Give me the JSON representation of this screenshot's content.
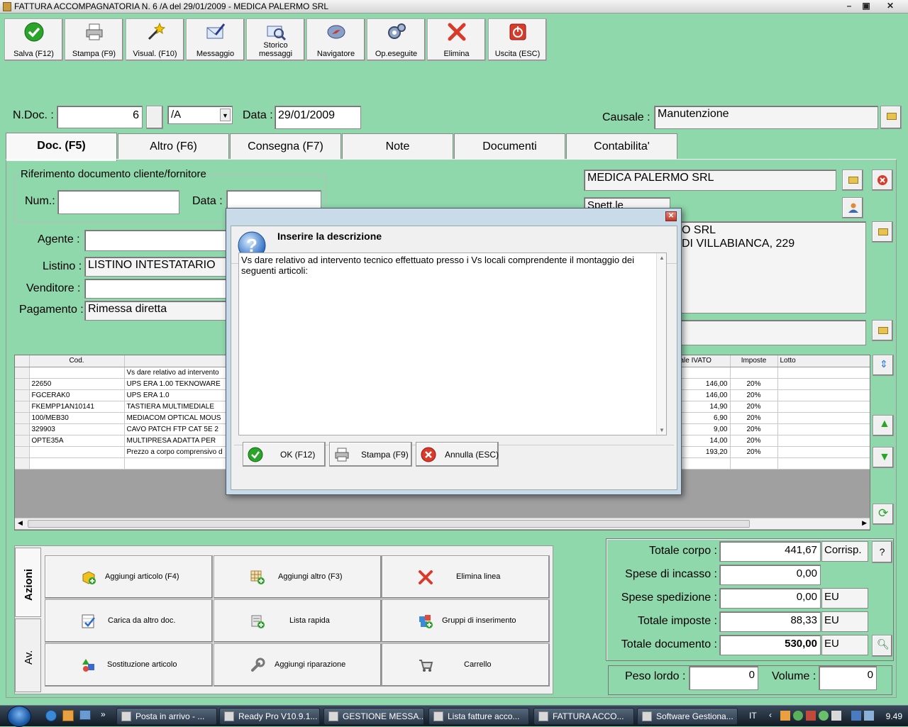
{
  "window": {
    "title": "FATTURA ACCOMPAGNATORIA N. 6 /A del 29/01/2009 - MEDICA PALERMO SRL"
  },
  "toolbar": {
    "buttons": [
      {
        "label": "Salva (F12)"
      },
      {
        "label": "Stampa (F9)"
      },
      {
        "label": "Visual. (F10)"
      },
      {
        "label": "Messaggio"
      },
      {
        "label": "Storico messaggi"
      },
      {
        "label": "Navigatore"
      },
      {
        "label": "Op.eseguite"
      },
      {
        "label": "Elimina"
      },
      {
        "label": "Uscita (ESC)"
      }
    ]
  },
  "header": {
    "ndoc_label": "N.Doc. :",
    "ndoc_value": "6",
    "series_value": "/A",
    "data_label": "Data :",
    "data_value": "29/01/2009",
    "causale_label": "Causale :",
    "causale_value": "Manutenzione"
  },
  "tabs": [
    {
      "label": "Doc. (F5)"
    },
    {
      "label": "Altro (F6)"
    },
    {
      "label": "Consegna (F7)"
    },
    {
      "label": "Note"
    },
    {
      "label": "Documenti"
    },
    {
      "label": "Contabilita'"
    }
  ],
  "riferimento": {
    "title": "Riferimento documento cliente/fornitore",
    "num_label": "Num.:",
    "num_value": "",
    "data_label": "Data :",
    "data_value": ""
  },
  "fields": {
    "agente_label": "Agente :",
    "agente_value": "",
    "listino_label": "Listino :",
    "listino_value": "LISTINO INTESTATARIO",
    "venditore_label": "Venditore :",
    "venditore_value": "",
    "pagamento_label": "Pagamento :",
    "pagamento_value": "Rimessa diretta"
  },
  "customer": {
    "name": "MEDICA PALERMO SRL",
    "salutation": "Spett.le",
    "address_line1": "O SRL",
    "address_line2": "DI VILLABIANCA, 229"
  },
  "grid": {
    "headers": [
      "",
      "Cod.",
      "",
      "ale IVATO",
      "Imposte",
      "Lotto"
    ],
    "rows": [
      {
        "cod": "",
        "desc": "Vs dare relativo ad intervento",
        "tot": "",
        "imp": ""
      },
      {
        "cod": "22650",
        "desc": "UPS ERA 1.00 TEKNOWARE",
        "tot": "146,00",
        "imp": "20%"
      },
      {
        "cod": "FGCERAK0",
        "desc": "UPS ERA 1.0",
        "tot": "146,00",
        "imp": "20%"
      },
      {
        "cod": "FKEMPP1AN10141",
        "desc": "TASTIERA MULTIMEDIALE",
        "tot": "14,90",
        "imp": "20%"
      },
      {
        "cod": "100/MEB30",
        "desc": "MEDIACOM OPTICAL MOUS",
        "tot": "6,90",
        "imp": "20%"
      },
      {
        "cod": "329903",
        "desc": "CAVO PATCH FTP CAT 5E 2",
        "tot": "9,00",
        "imp": "20%"
      },
      {
        "cod": "OPTE35A",
        "desc": "MULTIPRESA ADATTA PER",
        "tot": "14,00",
        "imp": "20%"
      },
      {
        "cod": "",
        "desc": "Prezzo a corpo comprensivo d",
        "tot": "193,20",
        "imp": "20%"
      },
      {
        "cod": "",
        "desc": "",
        "tot": "",
        "imp": ""
      }
    ]
  },
  "actions": {
    "tab_azioni": "Azioni",
    "tab_av": "Av.",
    "buttons": [
      {
        "label": "Aggiungi articolo (F4)"
      },
      {
        "label": "Aggiungi altro (F3)"
      },
      {
        "label": "Elimina linea"
      },
      {
        "label": "Carica da altro doc."
      },
      {
        "label": "Lista rapida"
      },
      {
        "label": "Gruppi di inserimento"
      },
      {
        "label": "Sostituzione articolo"
      },
      {
        "label": "Aggiungi riparazione"
      },
      {
        "label": "Carrello"
      }
    ]
  },
  "totals": {
    "corpo_label": "Totale corpo :",
    "corpo_value": "441,67",
    "corpo_mode": "Corrisp.",
    "corpo_help": "?",
    "incasso_label": "Spese di incasso :",
    "incasso_value": "0,00",
    "spedizione_label": "Spese spedizione :",
    "spedizione_value": "0,00",
    "spedizione_cur": "EU",
    "imposte_label": "Totale imposte :",
    "imposte_value": "88,33",
    "imposte_cur": "EU",
    "documento_label": "Totale documento :",
    "documento_value": "530,00",
    "documento_cur": "EU",
    "peso_label": "Peso lordo :",
    "peso_value": "0",
    "volume_label": "Volume :",
    "volume_value": "0"
  },
  "dialog": {
    "prompt": "Inserire la descrizione",
    "text": "Vs dare relativo ad intervento tecnico effettuato presso i Vs locali comprendente il montaggio dei seguenti articoli:",
    "ok_label": "OK (F12)",
    "print_label": "Stampa (F9)",
    "cancel_label": "Annulla (ESC)"
  },
  "taskbar": {
    "tasks": [
      {
        "label": "Posta in arrivo - ..."
      },
      {
        "label": "Ready Pro V10.9.1..."
      },
      {
        "label": "GESTIONE MESSA..."
      },
      {
        "label": "Lista fatture acco..."
      },
      {
        "label": "FATTURA ACCO..."
      },
      {
        "label": "Software Gestiona..."
      }
    ],
    "language": "IT",
    "clock": "9.49"
  },
  "colors": {
    "background": "#8fd8ab",
    "accent_red": "#d93a2a",
    "accent_green": "#2aa52a"
  }
}
